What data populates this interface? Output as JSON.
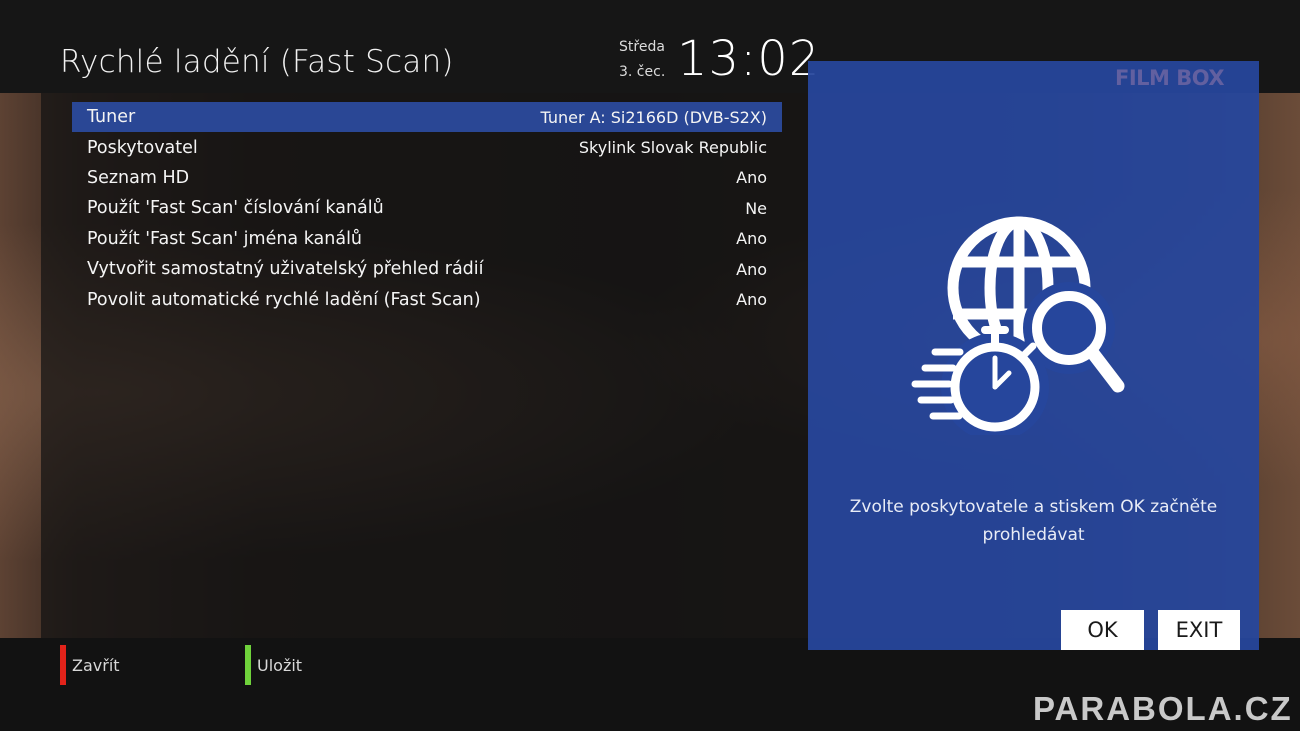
{
  "header": {
    "title": "Rychlé ladění (Fast Scan)",
    "day": "Středa",
    "date": "3. čec.",
    "time": "13:02"
  },
  "settings": [
    {
      "label": "Tuner",
      "value": "Tuner A: Si2166D (DVB-S2X)",
      "selected": true
    },
    {
      "label": "Poskytovatel",
      "value": "Skylink Slovak Republic"
    },
    {
      "label": "Seznam HD",
      "value": "Ano"
    },
    {
      "label": "Použít 'Fast Scan' číslování kanálů",
      "value": "Ne"
    },
    {
      "label": "Použít 'Fast Scan' jména kanálů",
      "value": "Ano"
    },
    {
      "label": "Vytvořit samostatný uživatelský přehled rádií",
      "value": "Ano"
    },
    {
      "label": "Povolit automatické rychlé ladění (Fast Scan)",
      "value": "Ano"
    }
  ],
  "info_panel": {
    "icon": "fast-scan-globe-stopwatch-icon",
    "text_line1": "Zvolte poskytovatele a stiskem OK začněte",
    "text_line2": "prohledávat",
    "ok_label": "OK",
    "exit_label": "EXIT",
    "bg_color": "#26469c"
  },
  "channel_logo": "FILM BOX",
  "color_keys": {
    "red_label": "Zavřít",
    "red_color": "#e2231a",
    "green_label": "Uložit",
    "green_color": "#6fd23b"
  },
  "watermark": "PARABOLA.CZ"
}
